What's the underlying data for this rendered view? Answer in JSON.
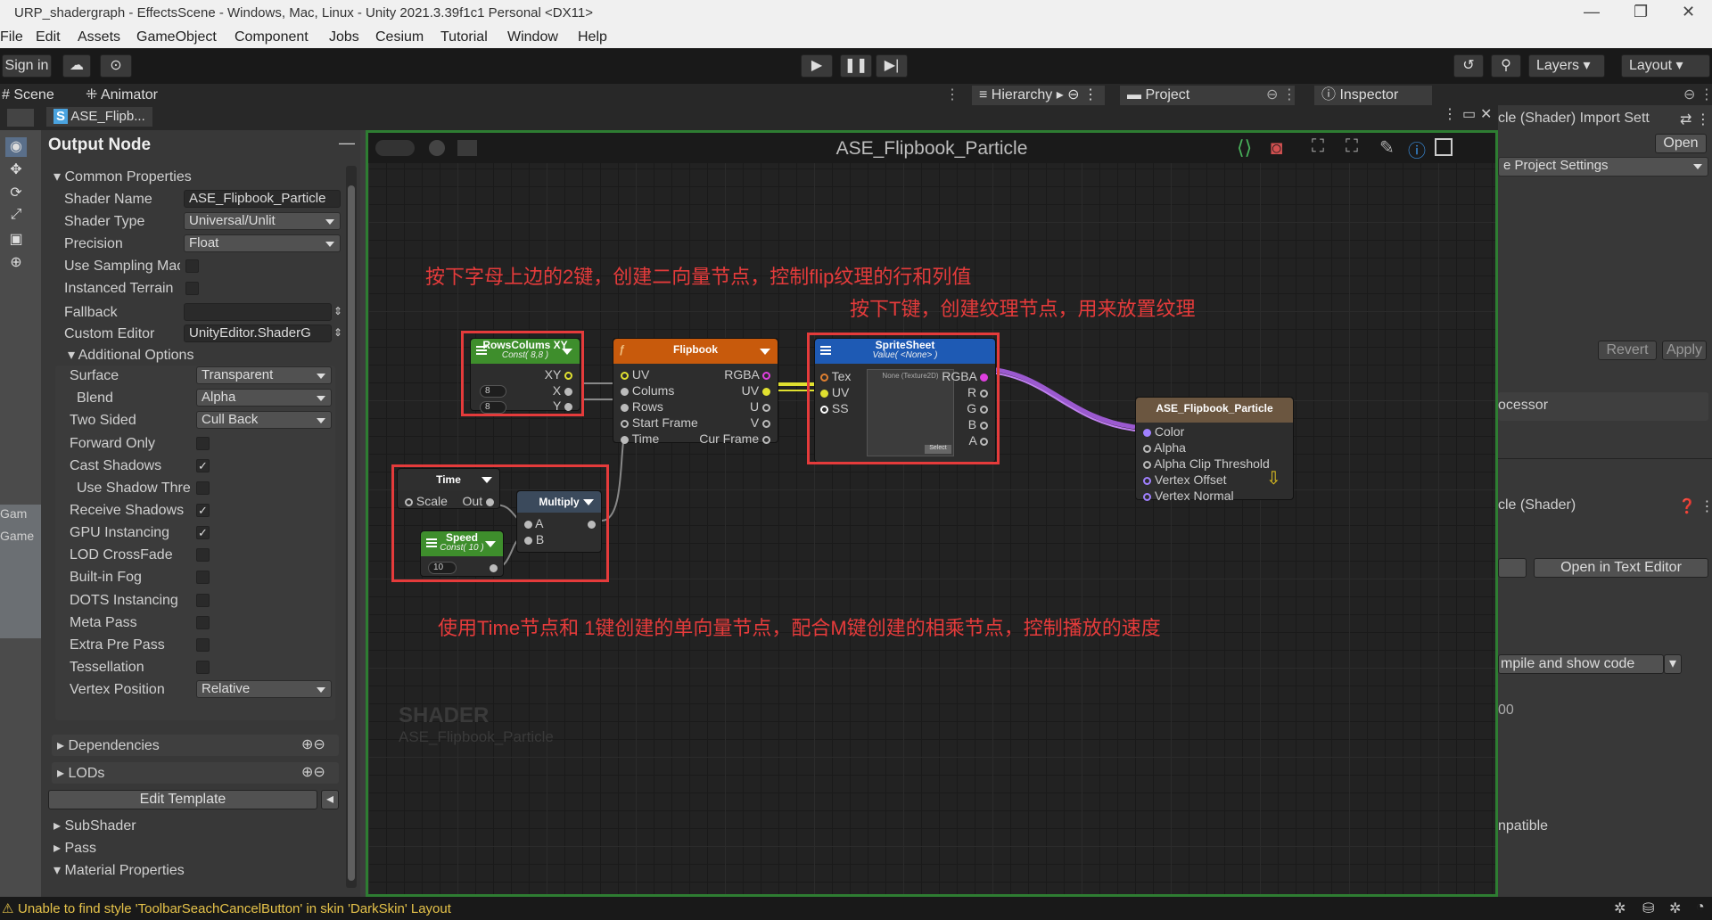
{
  "window": {
    "title": "URP_shadergraph - EffectsScene - Windows, Mac, Linux - Unity 2021.3.39f1c1 Personal <DX11>",
    "controls": [
      "—",
      "❐",
      "✕"
    ]
  },
  "menu": [
    "File",
    "Edit",
    "Assets",
    "GameObject",
    "Component",
    "Jobs",
    "Cesium",
    "Tutorial",
    "Window",
    "Help"
  ],
  "toolbar": {
    "sign_in": "Sign in",
    "layers": "Layers",
    "layout": "Layout"
  },
  "tabs": {
    "scene": "Scene",
    "animator": "Animator",
    "hierarchy": "Hierarchy",
    "project": "Project",
    "inspector": "Inspector",
    "graph_tab": "ASE_Flipb..."
  },
  "panel": {
    "title": "Output Node",
    "common": "Common Properties",
    "shader_name_label": "Shader Name",
    "shader_name": "ASE_Flipbook_Particle",
    "shader_type_label": "Shader Type",
    "shader_type": "Universal/Unlit",
    "precision_label": "Precision",
    "precision": "Float",
    "use_sampling_label": "Use Sampling Mac",
    "instanced_terrain_label": "Instanced Terrain",
    "fallback_label": "Fallback",
    "custom_editor_label": "Custom Editor",
    "custom_editor": "UnityEditor.ShaderG",
    "additional": "Additional Options",
    "surface_label": "Surface",
    "surface": "Transparent",
    "blend_label": "Blend",
    "blend": "Alpha",
    "two_sided_label": "Two Sided",
    "two_sided": "Cull Back",
    "forward_only_label": "Forward Only",
    "cast_shadows_label": "Cast Shadows",
    "use_shadow_label": "Use Shadow Thre",
    "receive_shadows_label": "Receive Shadows",
    "gpu_instancing_label": "GPU Instancing",
    "lod_crossfade_label": "LOD CrossFade",
    "builtin_fog_label": "Built-in Fog",
    "dots_label": "DOTS Instancing",
    "meta_pass_label": "Meta Pass",
    "extra_pre_pass_label": "Extra Pre Pass",
    "tessellation_label": "Tessellation",
    "vertex_position_label": "Vertex Position",
    "vertex_position": "Relative",
    "dependencies": "Dependencies",
    "lods": "LODs",
    "edit_template": "Edit Template",
    "subshader": "SubShader",
    "pass": "Pass",
    "material_properties": "Material Properties"
  },
  "graph": {
    "title": "ASE_Flipbook_Particle",
    "watermark_title": "SHADER",
    "watermark_sub": "ASE_Flipbook_Particle"
  },
  "nodes": {
    "rows": {
      "title": "RowsColums XY",
      "sub": "Const( 8,8 )",
      "out_xy": "XY",
      "x": "X",
      "y": "Y",
      "vx": "8",
      "vy": "8"
    },
    "flipbook": {
      "title": "Flipbook",
      "in": [
        "UV",
        "Colums",
        "Rows",
        "Start Frame",
        "Time"
      ],
      "out": [
        "RGBA",
        "UV",
        "U",
        "V",
        "Cur Frame"
      ]
    },
    "sprite": {
      "title": "SpriteSheet",
      "sub": "Value( <None> )",
      "in": [
        "Tex",
        "UV",
        "SS"
      ],
      "out": [
        "RGBA",
        "R",
        "G",
        "B",
        "A"
      ],
      "preview": "None (Texture2D)",
      "select": "Select"
    },
    "output": {
      "title": "ASE_Flipbook_Particle",
      "ports": [
        "Color",
        "Alpha",
        "Alpha Clip Threshold",
        "Vertex Offset",
        "Vertex Normal"
      ]
    },
    "time": {
      "title": "Time",
      "scale": "Scale",
      "out": "Out"
    },
    "multiply": {
      "title": "Multiply",
      "a": "A",
      "b": "B"
    },
    "speed": {
      "title": "Speed",
      "sub": "Const( 10 )",
      "value": "10"
    }
  },
  "annotations": {
    "a1": "按下字母上边的2键，创建二向量节点，控制flip纹理的行和列值",
    "a2": "按下T键，创建纹理节点，用来放置纹理",
    "a3": "使用Time节点和 1键创建的单向量节点，配合M键创建的相乘节点，控制播放的速度"
  },
  "inspector": {
    "import_title": "cle (Shader) Import Sett",
    "open": "Open",
    "project_settings": "e Project Settings",
    "revert": "Revert",
    "apply": "Apply",
    "processor": "ocessor",
    "shader_title": "cle (Shader)",
    "open_text_editor": "Open in Text Editor",
    "compile": "mpile and show code",
    "partial_00": "00",
    "compatible": "npatible"
  },
  "left_strip": {
    "game1": "Gam",
    "game2": "Game"
  },
  "status": {
    "message": "Unable to find style 'ToolbarSeachCancelButton' in skin 'DarkSkin' Layout"
  },
  "colors": {
    "green_header": "#3e8e2c",
    "orange_header": "#c85a0c",
    "blue_header": "#1e5ab4",
    "brown_header": "#6b5640",
    "slate_header": "#3b4a5c",
    "annotation_red": "#e53b3b",
    "canvas_border": "#2e7d32"
  }
}
